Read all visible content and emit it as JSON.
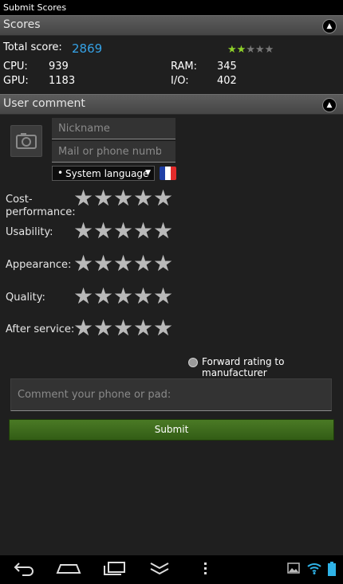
{
  "window": {
    "title": "Submit Scores"
  },
  "scores": {
    "header": "Scores",
    "total_label": "Total score:",
    "total_value": "2869",
    "stars": {
      "filled": 2,
      "total": 5
    },
    "cpu_label": "CPU:",
    "cpu_value": "939",
    "gpu_label": "GPU:",
    "gpu_value": "1183",
    "ram_label": "RAM:",
    "ram_value": "345",
    "io_label": "I/O:",
    "io_value": "402"
  },
  "comment": {
    "header": "User comment",
    "nickname_placeholder": "Nickname",
    "contact_placeholder": "Mail or phone number",
    "language_selected": "System language",
    "ratings": [
      {
        "label_line1": "Cost-",
        "label_line2": "performance:",
        "stars": 0
      },
      {
        "label": "Usability:",
        "stars": 0
      },
      {
        "label": "Appearance:",
        "stars": 0
      },
      {
        "label": "Quality:",
        "stars": 0
      },
      {
        "label": "After service:",
        "stars": 0
      }
    ],
    "forward_label": "Forward rating to manufacturer",
    "comment_placeholder": "Comment your phone or pad:",
    "submit_label": "Submit"
  },
  "colors": {
    "accent_blue": "#35a2e6",
    "submit_green": "#3d6b1d",
    "star_green": "#8fd22a",
    "wifi_blue": "#2fb3e8"
  },
  "navbar": {
    "icons": [
      "back-icon",
      "home-icon",
      "recent-apps-icon",
      "hide-keyboard-icon",
      "menu-icon"
    ],
    "status_icons": [
      "gallery-icon",
      "wifi-icon",
      "battery-icon"
    ]
  }
}
